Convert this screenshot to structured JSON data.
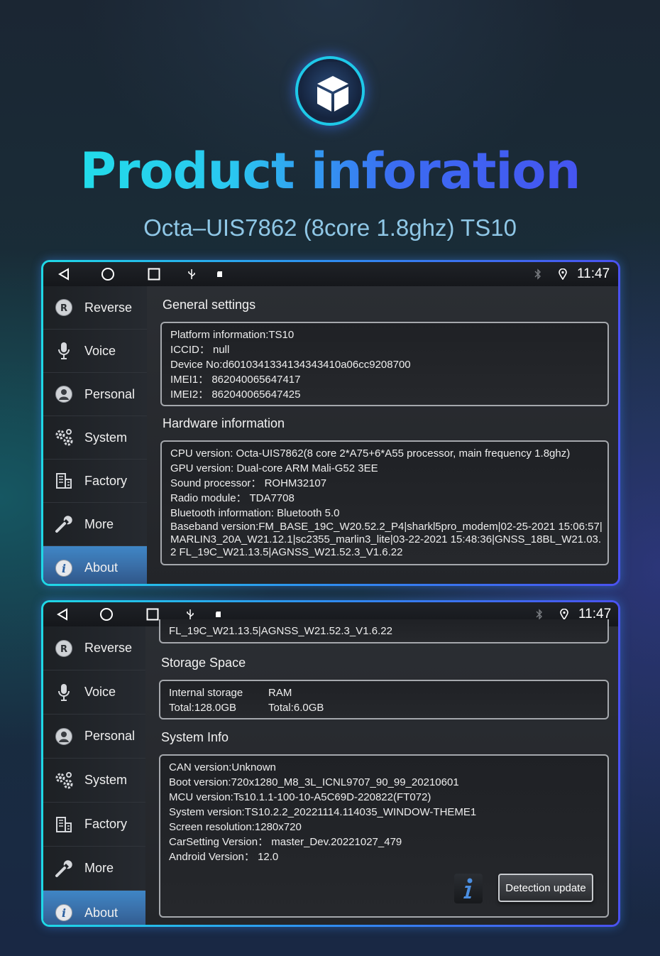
{
  "header": {
    "logo_icon": "cube-icon",
    "title": "Product inforation",
    "subtitle": "Octa–UIS7862 (8core 1.8ghz) TS10"
  },
  "screens": [
    {
      "statusbar": {
        "icons": [
          "back-triangle-icon",
          "home-circle-icon",
          "recents-square-icon",
          "usb-icon",
          "sd-card-icon",
          "bluetooth-icon",
          "location-pin-icon"
        ],
        "time": "11:47"
      },
      "sidebar": {
        "items": [
          {
            "label": "Reverse",
            "icon": "reverse-r-icon"
          },
          {
            "label": "Voice",
            "icon": "microphone-icon"
          },
          {
            "label": "Personal",
            "icon": "person-icon"
          },
          {
            "label": "System",
            "icon": "gears-icon"
          },
          {
            "label": "Factory",
            "icon": "factory-icon"
          },
          {
            "label": "More",
            "icon": "wrench-icon"
          },
          {
            "label": "About",
            "icon": "info-icon",
            "active": true
          }
        ]
      },
      "sections": {
        "general_title": "General settings",
        "general_lines": [
          "Platform information:TS10",
          "ICCID： null",
          "Device No:d6010341334134343410a06cc9208700",
          "IMEI1： 862040065647417",
          "IMEI2： 862040065647425"
        ],
        "hardware_title": "Hardware information",
        "hardware_lines": [
          "CPU version: Octa-UIS7862(8 core 2*A75+6*A55 processor, main frequency 1.8ghz)",
          "GPU version: Dual-core ARM Mali-G52 3EE",
          "Sound processor： ROHM32107",
          "Radio module： TDA7708",
          "Bluetooth information: Bluetooth 5.0"
        ],
        "baseband": "Baseband version:FM_BASE_19C_W20.52.2_P4|sharkl5pro_modem|02-25-2021 15:06:57|MARLIN3_20A_W21.12.1|sc2355_marlin3_lite|03-22-2021 15:48:36|GNSS_18BL_W21.03.2 FL_19C_W21.13.5|AGNSS_W21.52.3_V1.6.22"
      }
    },
    {
      "statusbar": {
        "time": "11:47"
      },
      "sidebar": {
        "items": [
          {
            "label": "Reverse"
          },
          {
            "label": "Voice"
          },
          {
            "label": "Personal"
          },
          {
            "label": "System"
          },
          {
            "label": "Factory"
          },
          {
            "label": "More"
          },
          {
            "label": "About",
            "active": true
          }
        ]
      },
      "sections": {
        "top_line": "FL_19C_W21.13.5|AGNSS_W21.52.3_V1.6.22",
        "storage_title": "Storage Space",
        "storage": {
          "internal_label": "Internal storage",
          "internal_total": "Total:128.0GB",
          "ram_label": "RAM",
          "ram_total": "Total:6.0GB"
        },
        "sysinfo_title": "System Info",
        "sysinfo_lines": [
          "CAN version:Unknown",
          "Boot version:720x1280_M8_3L_ICNL9707_90_99_20210601",
          "MCU version:Ts10.1.1-100-10-A5C69D-220822(FT072)",
          "System version:TS10.2.2_20221114.114035_WINDOW-THEME1",
          "Screen resolution:1280x720",
          "CarSetting Version： master_Dev.20221027_479",
          "Android Version： 12.0"
        ],
        "detect_button": "Detection update"
      }
    }
  ]
}
